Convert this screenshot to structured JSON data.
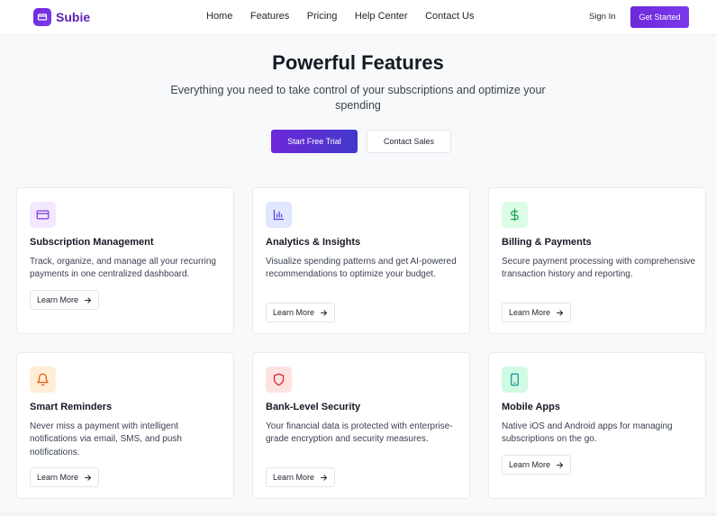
{
  "brand": {
    "name": "Subie",
    "accent": "#6d28d9"
  },
  "nav": {
    "links": [
      "Home",
      "Features",
      "Pricing",
      "Help Center",
      "Contact Us"
    ],
    "sign_in": "Sign In",
    "get_started": "Get Started"
  },
  "hero": {
    "title": "Powerful Features",
    "subtitle": "Everything you need to take control of your subscriptions and optimize your spending",
    "primary_cta": "Start Free Trial",
    "secondary_cta": "Contact Sales"
  },
  "features": [
    {
      "icon": "credit-card-icon",
      "icon_bg": "#f3e8ff",
      "icon_color": "#7c3aed",
      "title": "Subscription Management",
      "description": "Track, organize, and manage all your recurring payments in one centralized dashboard.",
      "cta": "Learn More"
    },
    {
      "icon": "bar-chart-icon",
      "icon_bg": "#e0e7ff",
      "icon_color": "#4f46e5",
      "title": "Analytics & Insights",
      "description": "Visualize spending patterns and get AI-powered recommendations to optimize your budget.",
      "cta": "Learn More"
    },
    {
      "icon": "dollar-icon",
      "icon_bg": "#dcfce7",
      "icon_color": "#16a34a",
      "title": "Billing & Payments",
      "description": "Secure payment processing with comprehensive transaction history and reporting.",
      "cta": "Learn More"
    },
    {
      "icon": "bell-icon",
      "icon_bg": "#ffedd5",
      "icon_color": "#ea580c",
      "title": "Smart Reminders",
      "description": "Never miss a payment with intelligent notifications via email, SMS, and push notifications.",
      "cta": "Learn More"
    },
    {
      "icon": "shield-icon",
      "icon_bg": "#fee2e2",
      "icon_color": "#dc2626",
      "title": "Bank-Level Security",
      "description": "Your financial data is protected with enterprise-grade encryption and security measures.",
      "cta": "Learn More"
    },
    {
      "icon": "smartphone-icon",
      "icon_bg": "#d1fae5",
      "icon_color": "#0d9488",
      "title": "Mobile Apps",
      "description": "Native iOS and Android apps for managing subscriptions on the go.",
      "cta": "Learn More"
    }
  ]
}
